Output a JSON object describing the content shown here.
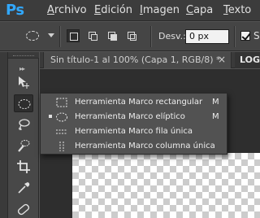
{
  "app": {
    "logo": "Ps",
    "brand_color": "#31a8ff"
  },
  "menu": [
    {
      "label": "Archivo",
      "mnemonic": "A",
      "rest": "rchivo"
    },
    {
      "label": "Edición",
      "mnemonic": "E",
      "rest": "dición"
    },
    {
      "label": "Imagen",
      "mnemonic": "I",
      "rest": "magen"
    },
    {
      "label": "Capa",
      "mnemonic": "C",
      "rest": "apa"
    },
    {
      "label": "Texto",
      "mnemonic": "T",
      "rest": "exto"
    }
  ],
  "options": {
    "tool_preset_icon": "elliptical-marquee-icon",
    "modes": [
      {
        "name": "new-selection",
        "icon": "new-selection-icon",
        "active": true
      },
      {
        "name": "add-to-selection",
        "icon": "add-selection-icon",
        "active": false
      },
      {
        "name": "subtract-from-selection",
        "icon": "subtract-selection-icon",
        "active": false
      },
      {
        "name": "intersect-with-selection",
        "icon": "intersect-selection-icon",
        "active": false
      }
    ],
    "feather_label": "Desv.:",
    "feather_value": "0 px",
    "antialias_checked": true,
    "antialias_label": "Su"
  },
  "tabs": [
    {
      "label": "Sin título-1 al 100% (Capa 1, RGB/8) *",
      "close": "×",
      "active": false
    },
    {
      "label": "LOGO",
      "active": true
    }
  ],
  "tools": [
    {
      "name": "move-tool",
      "icon": "move-icon"
    },
    {
      "name": "marquee-tool",
      "icon": "elliptical-marquee-icon",
      "active": true
    },
    {
      "name": "lasso-tool",
      "icon": "lasso-icon"
    },
    {
      "name": "quick-selection-tool",
      "icon": "quick-selection-icon"
    },
    {
      "name": "crop-tool",
      "icon": "crop-icon"
    },
    {
      "name": "eyedropper-tool",
      "icon": "eyedropper-icon"
    },
    {
      "name": "healing-brush-tool",
      "icon": "bandage-icon"
    }
  ],
  "flyout": {
    "items": [
      {
        "label": "Herramienta Marco rectangular",
        "shortcut": "M",
        "icon": "rectangular-marquee-icon",
        "selected": false
      },
      {
        "label": "Herramienta Marco elíptico",
        "shortcut": "M",
        "icon": "elliptical-marquee-icon",
        "selected": true
      },
      {
        "label": "Herramienta Marco fila única",
        "shortcut": "",
        "icon": "single-row-marquee-icon",
        "selected": false
      },
      {
        "label": "Herramienta Marco columna única",
        "shortcut": "",
        "icon": "single-column-marquee-icon",
        "selected": false
      }
    ]
  }
}
